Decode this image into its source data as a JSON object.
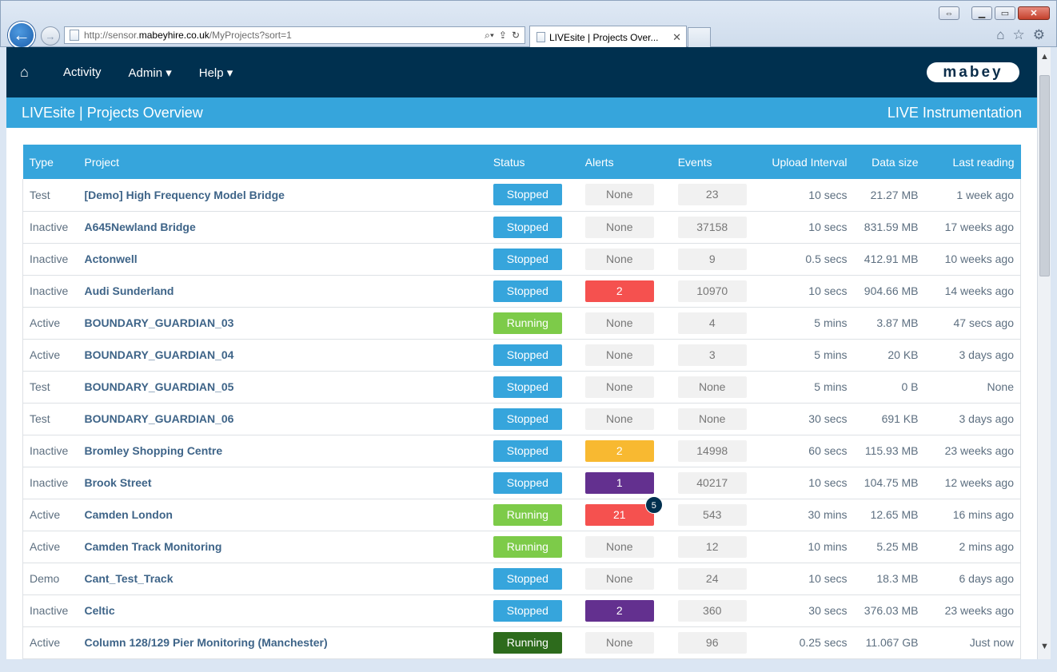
{
  "browser": {
    "url_prefix": "http://sensor.",
    "url_domain": "mabeyhire.co.uk",
    "url_path": "/MyProjects?sort=1",
    "tab_title": "LIVEsite | Projects Over..."
  },
  "nav": {
    "items": [
      "Activity",
      "Admin ▾",
      "Help ▾"
    ],
    "logo": "mabey"
  },
  "title": {
    "left": "LIVEsite | Projects Overview",
    "right": "LIVE Instrumentation"
  },
  "table": {
    "headers": [
      "Type",
      "Project",
      "Status",
      "Alerts",
      "Events",
      "Upload Interval",
      "Data size",
      "Last reading"
    ],
    "rows": [
      {
        "type": "Test",
        "project": "[Demo] High Frequency Model Bridge",
        "status": "Stopped",
        "status_kind": "stopped",
        "alerts": "None",
        "alerts_kind": "none",
        "events": "23",
        "upload": "10 secs",
        "size": "21.27 MB",
        "last": "1 week ago"
      },
      {
        "type": "Inactive",
        "project": "A645Newland Bridge",
        "status": "Stopped",
        "status_kind": "stopped",
        "alerts": "None",
        "alerts_kind": "none",
        "events": "37158",
        "upload": "10 secs",
        "size": "831.59 MB",
        "last": "17 weeks ago"
      },
      {
        "type": "Inactive",
        "project": "Actonwell",
        "status": "Stopped",
        "status_kind": "stopped",
        "alerts": "None",
        "alerts_kind": "none",
        "events": "9",
        "upload": "0.5 secs",
        "size": "412.91 MB",
        "last": "10 weeks ago"
      },
      {
        "type": "Inactive",
        "project": "Audi Sunderland",
        "status": "Stopped",
        "status_kind": "stopped",
        "alerts": "2",
        "alerts_kind": "red",
        "events": "10970",
        "upload": "10 secs",
        "size": "904.66 MB",
        "last": "14 weeks ago"
      },
      {
        "type": "Active",
        "project": "BOUNDARY_GUARDIAN_03",
        "status": "Running",
        "status_kind": "running",
        "alerts": "None",
        "alerts_kind": "none",
        "events": "4",
        "upload": "5 mins",
        "size": "3.87 MB",
        "last": "47 secs ago"
      },
      {
        "type": "Active",
        "project": "BOUNDARY_GUARDIAN_04",
        "status": "Stopped",
        "status_kind": "stopped",
        "alerts": "None",
        "alerts_kind": "none",
        "events": "3",
        "upload": "5 mins",
        "size": "20 KB",
        "last": "3 days ago"
      },
      {
        "type": "Test",
        "project": "BOUNDARY_GUARDIAN_05",
        "status": "Stopped",
        "status_kind": "stopped",
        "alerts": "None",
        "alerts_kind": "none",
        "events": "None",
        "upload": "5 mins",
        "size": "0 B",
        "last": "None"
      },
      {
        "type": "Test",
        "project": "BOUNDARY_GUARDIAN_06",
        "status": "Stopped",
        "status_kind": "stopped",
        "alerts": "None",
        "alerts_kind": "none",
        "events": "None",
        "upload": "30 secs",
        "size": "691 KB",
        "last": "3 days ago"
      },
      {
        "type": "Inactive",
        "project": "Bromley Shopping Centre",
        "status": "Stopped",
        "status_kind": "stopped",
        "alerts": "2",
        "alerts_kind": "amber",
        "events": "14998",
        "upload": "60 secs",
        "size": "115.93 MB",
        "last": "23 weeks ago"
      },
      {
        "type": "Inactive",
        "project": "Brook Street",
        "status": "Stopped",
        "status_kind": "stopped",
        "alerts": "1",
        "alerts_kind": "purple",
        "events": "40217",
        "upload": "10 secs",
        "size": "104.75 MB",
        "last": "12 weeks ago"
      },
      {
        "type": "Active",
        "project": "Camden London",
        "status": "Running",
        "status_kind": "running",
        "alerts": "21",
        "alerts_kind": "red",
        "alerts_badge": "5",
        "events": "543",
        "upload": "30 mins",
        "size": "12.65 MB",
        "last": "16 mins ago"
      },
      {
        "type": "Active",
        "project": "Camden Track Monitoring",
        "status": "Running",
        "status_kind": "running",
        "alerts": "None",
        "alerts_kind": "none",
        "events": "12",
        "upload": "10 mins",
        "size": "5.25 MB",
        "last": "2 mins ago"
      },
      {
        "type": "Demo",
        "project": "Cant_Test_Track",
        "status": "Stopped",
        "status_kind": "stopped",
        "alerts": "None",
        "alerts_kind": "none",
        "events": "24",
        "upload": "10 secs",
        "size": "18.3 MB",
        "last": "6 days ago"
      },
      {
        "type": "Inactive",
        "project": "Celtic",
        "status": "Stopped",
        "status_kind": "stopped",
        "alerts": "2",
        "alerts_kind": "purple",
        "events": "360",
        "upload": "30 secs",
        "size": "376.03 MB",
        "last": "23 weeks ago"
      },
      {
        "type": "Active",
        "project": "Column 128/129 Pier Monitoring (Manchester)",
        "status": "Running",
        "status_kind": "running-dark",
        "alerts": "None",
        "alerts_kind": "none",
        "events": "96",
        "upload": "0.25 secs",
        "size": "11.067 GB",
        "last": "Just now"
      }
    ]
  },
  "colors": {
    "navbar": "#00304f",
    "accent": "#36a5dc",
    "running": "#7dcb49",
    "alert_red": "#f5514f",
    "alert_amber": "#f8b931",
    "alert_purple": "#63308f"
  }
}
